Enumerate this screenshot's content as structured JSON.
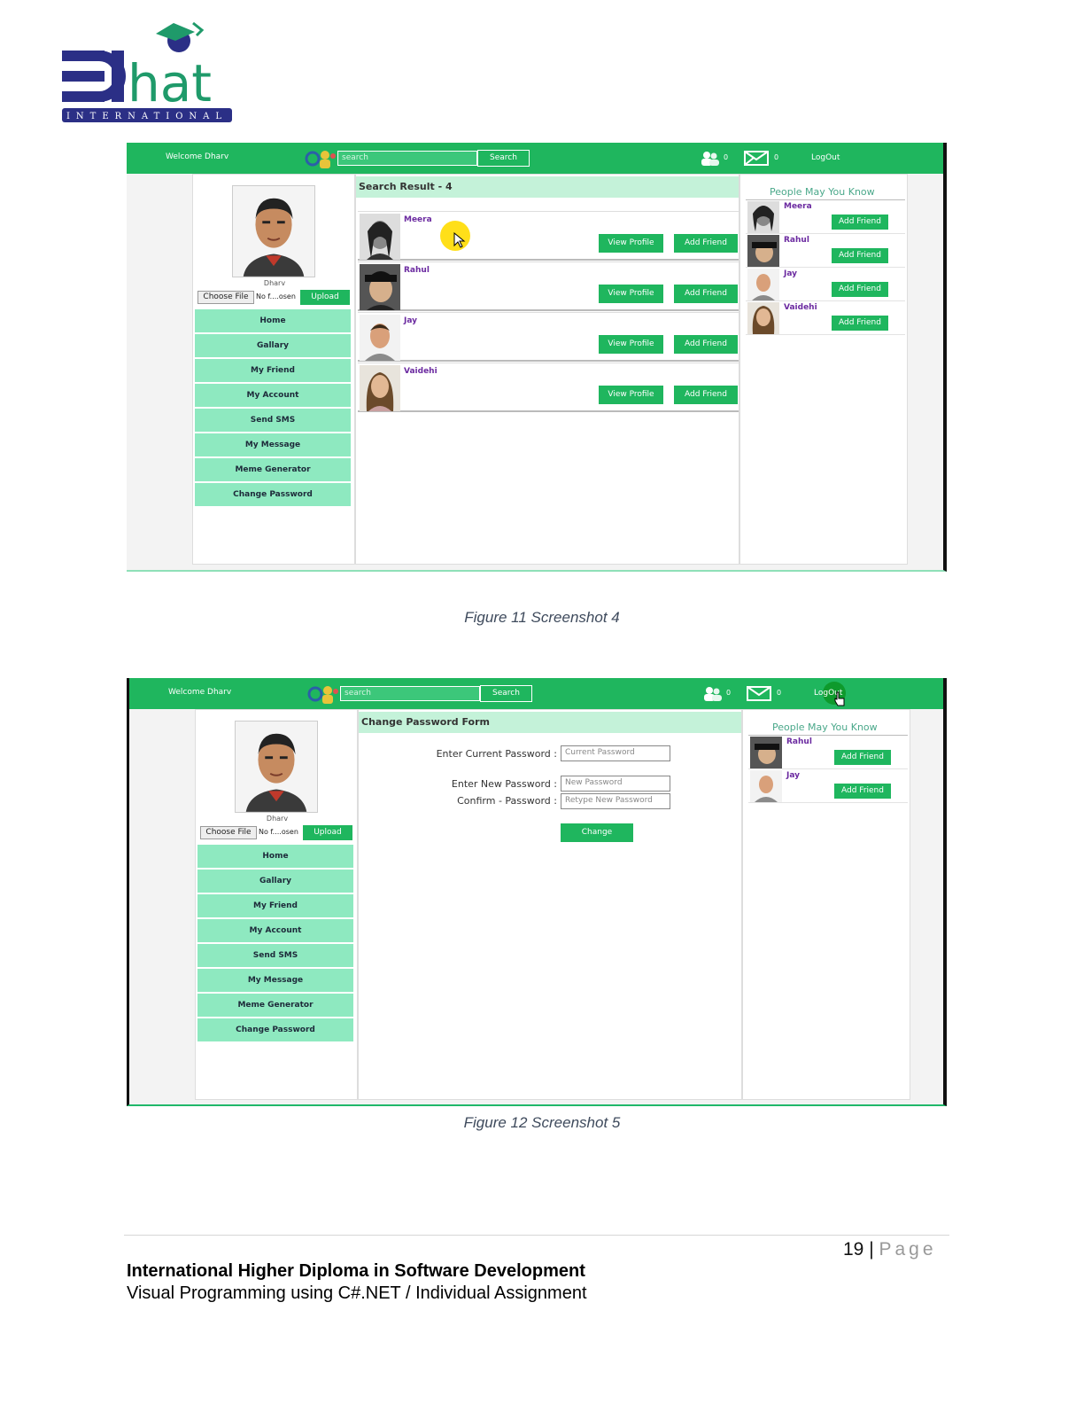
{
  "logo": {
    "caption": "INTERNATIONAL",
    "brand": "EDhat",
    "colors": {
      "navy": "#2b2f86",
      "green": "#1f9a6a"
    }
  },
  "screenshot1": {
    "topbar": {
      "welcome": "Welcome Dharv",
      "search_placeholder": "search",
      "search_button": "Search",
      "friend_count": "0",
      "message_count": "0",
      "logout": "LogOut"
    },
    "profile": {
      "name": "Dharv",
      "choose_file": "Choose File",
      "file_status": "No f....osen",
      "upload": "Upload"
    },
    "menu": [
      "Home",
      "Gallary",
      "My Friend",
      "My Account",
      "Send SMS",
      "My Message",
      "Meme Generator",
      "Change Password"
    ],
    "main_heading": "Search Result - 4",
    "results": [
      {
        "name": "Meera",
        "view": "View Profile",
        "add": "Add Friend"
      },
      {
        "name": "Rahul",
        "view": "View Profile",
        "add": "Add Friend"
      },
      {
        "name": "Jay",
        "view": "View Profile",
        "add": "Add Friend"
      },
      {
        "name": "Vaidehi",
        "view": "View Profile",
        "add": "Add Friend"
      }
    ],
    "people_title": "People May You Know",
    "suggestions": [
      {
        "name": "Meera",
        "add": "Add Friend"
      },
      {
        "name": "Rahul",
        "add": "Add Friend"
      },
      {
        "name": "Jay",
        "add": "Add Friend"
      },
      {
        "name": "Vaidehi",
        "add": "Add Friend"
      }
    ]
  },
  "caption1": "Figure 11 Screenshot 4",
  "screenshot2": {
    "topbar": {
      "welcome": "Welcome Dharv",
      "search_placeholder": "search",
      "search_button": "Search",
      "friend_count": "0",
      "message_count": "0",
      "logout": "LogOut"
    },
    "profile": {
      "name": "Dharv",
      "choose_file": "Choose File",
      "file_status": "No f....osen",
      "upload": "Upload"
    },
    "menu": [
      "Home",
      "Gallary",
      "My Friend",
      "My Account",
      "Send SMS",
      "My Message",
      "Meme Generator",
      "Change Password"
    ],
    "main_heading": "Change Password Form",
    "form": {
      "current_label": "Enter Current Password :",
      "current_placeholder": "Current Password",
      "new_label": "Enter New Password :",
      "new_placeholder": "New Password",
      "confirm_label": "Confirm - Password :",
      "confirm_placeholder": "Retype New Password",
      "submit": "Change"
    },
    "people_title": "People May You Know",
    "suggestions": [
      {
        "name": "Rahul",
        "add": "Add Friend"
      },
      {
        "name": "Jay",
        "add": "Add Friend"
      }
    ]
  },
  "caption2": "Figure 12 Screenshot 5",
  "footer": {
    "page_number": "19",
    "page_sep": " | ",
    "page_word": "Page",
    "line1": "International Higher Diploma in Software Development",
    "line2": "Visual Programming using C#.NET / Individual Assignment"
  }
}
